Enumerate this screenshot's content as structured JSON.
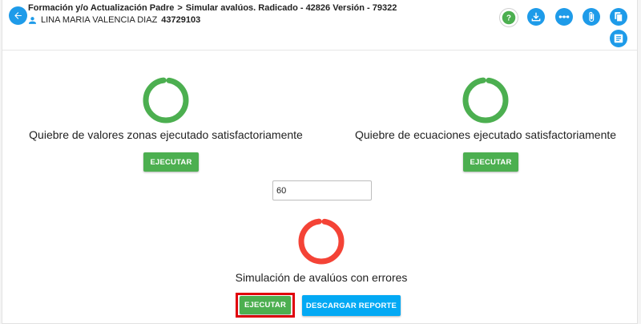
{
  "header": {
    "breadcrumb_parent": "Formación y/o Actualización Padre",
    "breadcrumb_separator": ">",
    "breadcrumb_current": "Simular avalúos. Radicado - 42826 Versión - 79322",
    "user_name": "LINA MARIA VALENCIA DIAZ",
    "user_id": "43729103"
  },
  "toolbar_icons": [
    "help-icon",
    "download-icon",
    "more-horizontal-icon",
    "attach-icon",
    "copy-icon",
    "list-icon"
  ],
  "sections": {
    "zonas": {
      "message": "Quiebre de valores zonas ejecutado satisfactoriamente",
      "button_label": "EJECUTAR",
      "status_color": "#4caf50"
    },
    "ecuaciones": {
      "message": "Quiebre de ecuaciones ejecutado satisfactoriamente",
      "button_label": "EJECUTAR",
      "status_color": "#4caf50"
    },
    "parameter": {
      "value": "60"
    },
    "simulacion": {
      "message": "Simulación de avalúos con errores",
      "button_label": "EJECUTAR",
      "report_button_label": "DESCARGAR REPORTE",
      "status_color": "#f44336"
    }
  },
  "colors": {
    "primary": "#1e9be9",
    "success": "#4caf50",
    "error": "#f44336",
    "report": "#03a9f4",
    "highlight": "#e0000b"
  }
}
